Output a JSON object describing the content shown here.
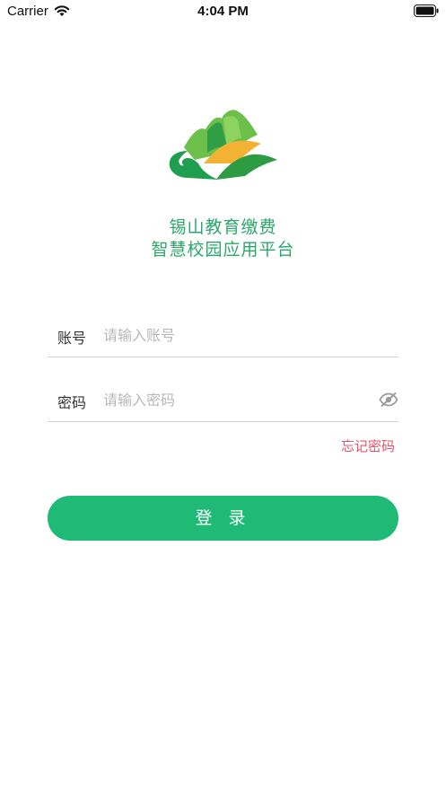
{
  "status_bar": {
    "carrier": "Carrier",
    "time": "4:04 PM"
  },
  "app": {
    "title_line1": "锡山教育缴费",
    "title_line2": "智慧校园应用平台",
    "accent_color": "#1fba76",
    "title_color": "#2aa86a",
    "link_color": "#e6536d"
  },
  "form": {
    "account_label": "账号",
    "account_placeholder": "请输入账号",
    "account_value": "",
    "password_label": "密码",
    "password_placeholder": "请输入密码",
    "password_value": "",
    "password_toggle_icon": "eye-slash-icon",
    "forgot_label": "忘记密码",
    "login_label": "登 录"
  }
}
